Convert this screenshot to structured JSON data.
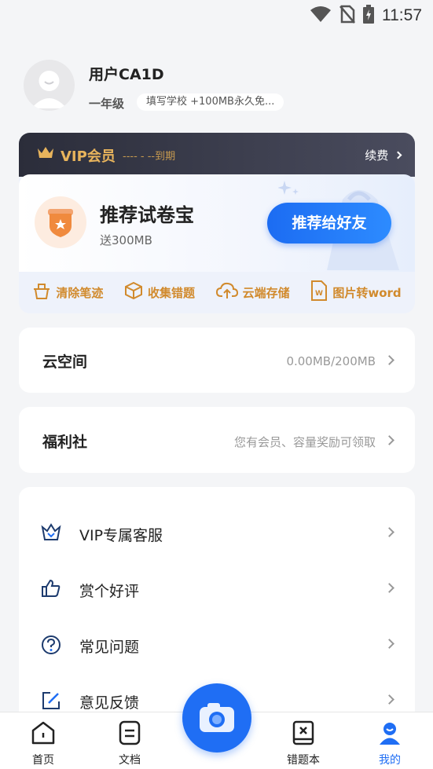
{
  "status_bar": {
    "time": "11:57",
    "icons": [
      "wifi-icon",
      "no-sim-icon",
      "battery-charging-icon"
    ]
  },
  "profile": {
    "username": "用户CA1D",
    "grade": "一年级",
    "school_tip": "填写学校 +100MB永久免..."
  },
  "vip": {
    "title": "VIP会员",
    "expire": "---- - --到期",
    "renew_label": "续费",
    "recommend_title": "推荐试卷宝",
    "recommend_subtitle": "送300MB",
    "recommend_button": "推荐给好友",
    "features": [
      {
        "icon": "eraser-icon",
        "label": "清除笔迹"
      },
      {
        "icon": "box-icon",
        "label": "收集错题"
      },
      {
        "icon": "cloud-upload-icon",
        "label": "云端存储"
      },
      {
        "icon": "word-document-icon",
        "label": "图片转word"
      }
    ],
    "accent_color": "#d18a2c"
  },
  "cloud_space": {
    "title": "云空间",
    "value": "0.00MB/200MB"
  },
  "welfare": {
    "title": "福利社",
    "value": "您有会员、容量奖励可领取"
  },
  "menu": [
    {
      "icon": "vip-service-icon",
      "label": "VIP专属客服"
    },
    {
      "icon": "thumbs-up-icon",
      "label": "赏个好评"
    },
    {
      "icon": "question-icon",
      "label": "常见问题"
    },
    {
      "icon": "edit-feedback-icon",
      "label": "意见反馈"
    }
  ],
  "tabbar": {
    "tabs": [
      {
        "label": "首页",
        "icon": "home-icon"
      },
      {
        "label": "文档",
        "icon": "document-icon"
      },
      {
        "label": "错题本",
        "icon": "mistake-book-icon"
      },
      {
        "label": "我的",
        "icon": "profile-icon",
        "active": true
      }
    ],
    "camera_icon": "camera-icon",
    "active_color": "#1f6ef4"
  }
}
